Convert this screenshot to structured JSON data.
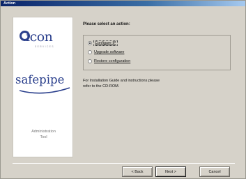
{
  "window": {
    "title": "Action"
  },
  "left_panel": {
    "logo_icon_text": "icon",
    "logo_icon_sub": "SERVICES",
    "logo_safepipe_text": "safepipe",
    "admin_label_line1": "Administration",
    "admin_label_line2": "Tool"
  },
  "main": {
    "heading": "Please select an action:",
    "options": [
      {
        "label": "Configure IP",
        "checked": true
      },
      {
        "label": "Upgrade software",
        "checked": false
      },
      {
        "label": "Restore configuration",
        "checked": false
      }
    ],
    "info_line1": "For Installation Guide and instructions please",
    "info_line2": "refer to the CD-ROM."
  },
  "buttons": {
    "back": "< Back",
    "next": "Next >",
    "cancel": "Cancel"
  },
  "colors": {
    "titlebar_start": "#0a246a",
    "brand_blue": "#2a3f8c",
    "dialog_bg": "#d6d2c9"
  }
}
